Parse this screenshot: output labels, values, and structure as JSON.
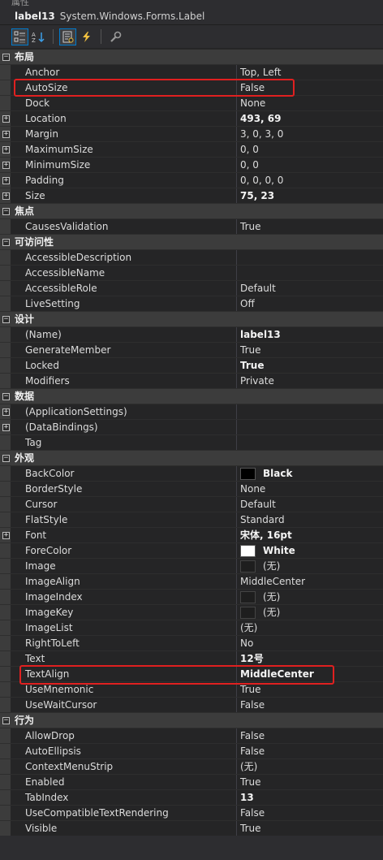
{
  "window": {
    "title": "属性"
  },
  "object": {
    "name": "label13",
    "type": "System.Windows.Forms.Label"
  },
  "toolbar": {
    "buttons": [
      {
        "name": "categorized-button",
        "icon": "categorized-icon",
        "active": true
      },
      {
        "name": "alphabetical-button",
        "icon": "sort-az-icon",
        "active": false
      },
      {
        "name": "properties-button",
        "icon": "properties-icon",
        "active": true
      },
      {
        "name": "events-button",
        "icon": "lightning-icon",
        "active": false
      },
      {
        "name": "property-pages-button",
        "icon": "wrench-icon",
        "active": false
      }
    ]
  },
  "colors": {
    "black": "#000000",
    "white": "#ffffff",
    "empty": "#1e1e1e",
    "highlight": "#e02020"
  },
  "grid": {
    "rows": [
      {
        "type": "cat",
        "name": "布局"
      },
      {
        "type": "prop",
        "name": "Anchor",
        "value": "Top, Left"
      },
      {
        "type": "prop",
        "name": "AutoSize",
        "value": "False"
      },
      {
        "type": "prop",
        "name": "Dock",
        "value": "None"
      },
      {
        "type": "prop",
        "name": "Location",
        "value": "493, 69",
        "bold": true,
        "expand": true
      },
      {
        "type": "prop",
        "name": "Margin",
        "value": "3, 0, 3, 0",
        "expand": true
      },
      {
        "type": "prop",
        "name": "MaximumSize",
        "value": "0, 0",
        "expand": true
      },
      {
        "type": "prop",
        "name": "MinimumSize",
        "value": "0, 0",
        "expand": true
      },
      {
        "type": "prop",
        "name": "Padding",
        "value": "0, 0, 0, 0",
        "expand": true
      },
      {
        "type": "prop",
        "name": "Size",
        "value": "75, 23",
        "bold": true,
        "expand": true
      },
      {
        "type": "cat",
        "name": "焦点"
      },
      {
        "type": "prop",
        "name": "CausesValidation",
        "value": "True"
      },
      {
        "type": "cat",
        "name": "可访问性"
      },
      {
        "type": "prop",
        "name": "AccessibleDescription",
        "value": ""
      },
      {
        "type": "prop",
        "name": "AccessibleName",
        "value": ""
      },
      {
        "type": "prop",
        "name": "AccessibleRole",
        "value": "Default"
      },
      {
        "type": "prop",
        "name": "LiveSetting",
        "value": "Off"
      },
      {
        "type": "cat",
        "name": "设计"
      },
      {
        "type": "prop",
        "name": "(Name)",
        "value": "label13",
        "bold": true
      },
      {
        "type": "prop",
        "name": "GenerateMember",
        "value": "True"
      },
      {
        "type": "prop",
        "name": "Locked",
        "value": "True",
        "bold": true
      },
      {
        "type": "prop",
        "name": "Modifiers",
        "value": "Private"
      },
      {
        "type": "cat",
        "name": "数据"
      },
      {
        "type": "prop",
        "name": "(ApplicationSettings)",
        "value": "",
        "expand": true
      },
      {
        "type": "prop",
        "name": "(DataBindings)",
        "value": "",
        "expand": true
      },
      {
        "type": "prop",
        "name": "Tag",
        "value": ""
      },
      {
        "type": "cat",
        "name": "外观"
      },
      {
        "type": "prop",
        "name": "BackColor",
        "value": "Black",
        "bold": true,
        "swatch": "black"
      },
      {
        "type": "prop",
        "name": "BorderStyle",
        "value": "None"
      },
      {
        "type": "prop",
        "name": "Cursor",
        "value": "Default"
      },
      {
        "type": "prop",
        "name": "FlatStyle",
        "value": "Standard"
      },
      {
        "type": "prop",
        "name": "Font",
        "value": "宋体, 16pt",
        "bold": true,
        "expand": true
      },
      {
        "type": "prop",
        "name": "ForeColor",
        "value": "White",
        "bold": true,
        "swatch": "white"
      },
      {
        "type": "prop",
        "name": "Image",
        "value": "(无)",
        "swatch": "empty"
      },
      {
        "type": "prop",
        "name": "ImageAlign",
        "value": "MiddleCenter"
      },
      {
        "type": "prop",
        "name": "ImageIndex",
        "value": "(无)",
        "swatch": "empty"
      },
      {
        "type": "prop",
        "name": "ImageKey",
        "value": "(无)",
        "swatch": "empty"
      },
      {
        "type": "prop",
        "name": "ImageList",
        "value": "(无)"
      },
      {
        "type": "prop",
        "name": "RightToLeft",
        "value": "No"
      },
      {
        "type": "prop",
        "name": "Text",
        "value": "12号",
        "bold": true
      },
      {
        "type": "prop",
        "name": "TextAlign",
        "value": "MiddleCenter",
        "bold": true
      },
      {
        "type": "prop",
        "name": "UseMnemonic",
        "value": "True"
      },
      {
        "type": "prop",
        "name": "UseWaitCursor",
        "value": "False"
      },
      {
        "type": "cat",
        "name": "行为"
      },
      {
        "type": "prop",
        "name": "AllowDrop",
        "value": "False"
      },
      {
        "type": "prop",
        "name": "AutoEllipsis",
        "value": "False"
      },
      {
        "type": "prop",
        "name": "ContextMenuStrip",
        "value": "(无)"
      },
      {
        "type": "prop",
        "name": "Enabled",
        "value": "True"
      },
      {
        "type": "prop",
        "name": "TabIndex",
        "value": "13",
        "bold": true
      },
      {
        "type": "prop",
        "name": "UseCompatibleTextRendering",
        "value": "False"
      },
      {
        "type": "prop",
        "name": "Visible",
        "value": "True"
      }
    ]
  }
}
